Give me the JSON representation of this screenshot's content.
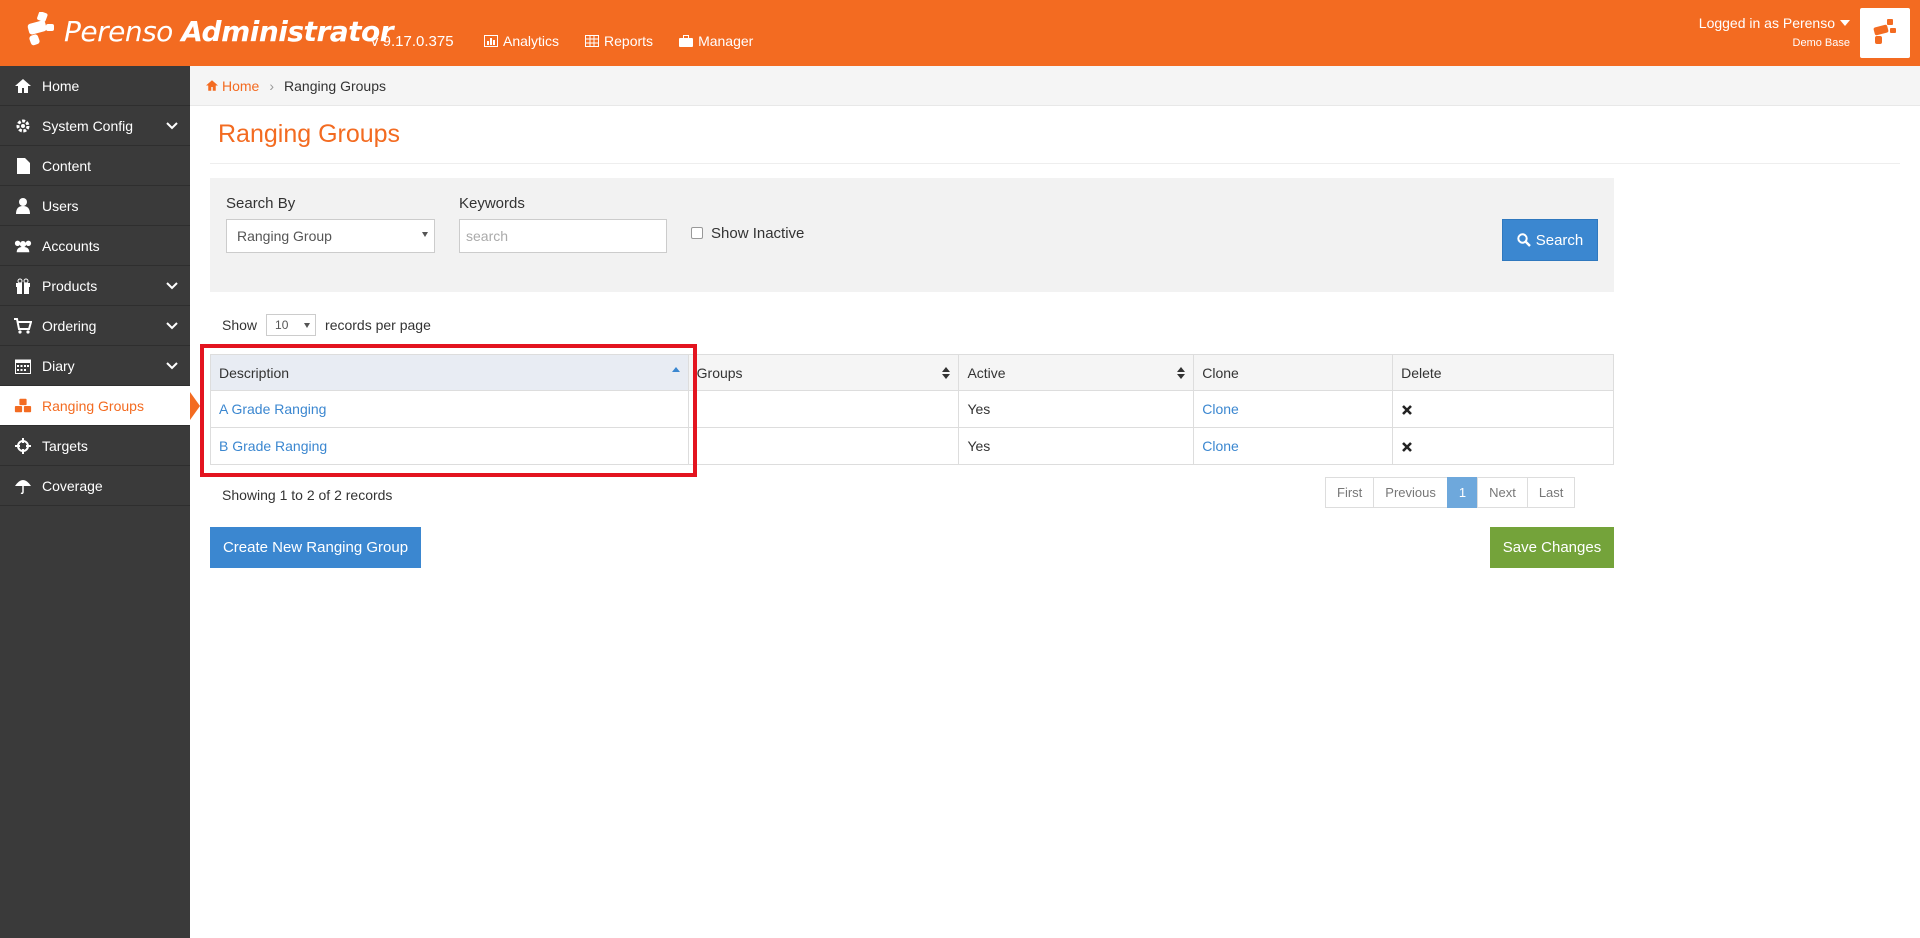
{
  "header": {
    "brand_name": "Perenso",
    "brand_suffix": "Administrator",
    "version": "v 9.17.0.375",
    "nav": [
      {
        "label": "Analytics",
        "icon": "chart-icon"
      },
      {
        "label": "Reports",
        "icon": "table-icon"
      },
      {
        "label": "Manager",
        "icon": "briefcase-icon"
      }
    ],
    "user_text": "Logged in as Perenso",
    "base_text": "Demo Base"
  },
  "sidebar": {
    "items": [
      {
        "label": "Home",
        "icon": "home-icon",
        "expandable": false
      },
      {
        "label": "System Config",
        "icon": "gear-icon",
        "expandable": true
      },
      {
        "label": "Content",
        "icon": "file-icon",
        "expandable": false
      },
      {
        "label": "Users",
        "icon": "user-icon",
        "expandable": false
      },
      {
        "label": "Accounts",
        "icon": "users-icon",
        "expandable": true
      },
      {
        "label": "Products",
        "icon": "gift-icon",
        "expandable": true
      },
      {
        "label": "Ordering",
        "icon": "cart-icon",
        "expandable": true
      },
      {
        "label": "Diary",
        "icon": "calendar-icon",
        "expandable": true
      },
      {
        "label": "Ranging Groups",
        "icon": "cubes-icon",
        "expandable": false,
        "active": true
      },
      {
        "label": "Targets",
        "icon": "crosshairs-icon",
        "expandable": false
      },
      {
        "label": "Coverage",
        "icon": "umbrella-icon",
        "expandable": false
      }
    ]
  },
  "breadcrumb": {
    "home": "Home",
    "current": "Ranging Groups"
  },
  "page": {
    "title": "Ranging Groups"
  },
  "search": {
    "search_by_label": "Search By",
    "search_by_value": "Ranging Group",
    "keywords_label": "Keywords",
    "keywords_placeholder": "search",
    "show_inactive_label": "Show Inactive",
    "search_button": "Search"
  },
  "paging": {
    "show_label": "Show",
    "per_page_value": "10",
    "per_page_suffix": "records per page",
    "summary": "Showing 1 to 2 of 2 records",
    "first": "First",
    "previous": "Previous",
    "current": "1",
    "next": "Next",
    "last": "Last"
  },
  "table": {
    "columns": [
      "Description",
      "Groups",
      "Active",
      "Clone",
      "Delete"
    ],
    "rows": [
      {
        "description": "A Grade Ranging",
        "groups": "",
        "active": "Yes",
        "clone": "Clone"
      },
      {
        "description": "B Grade Ranging",
        "groups": "",
        "active": "Yes",
        "clone": "Clone"
      }
    ]
  },
  "actions": {
    "create": "Create New Ranging Group",
    "save": "Save Changes"
  },
  "colors": {
    "brand": "#f36b21",
    "sidebar": "#3a3a3a",
    "primary": "#3b87d0",
    "success": "#74a33a",
    "highlight": "#e3141f"
  }
}
